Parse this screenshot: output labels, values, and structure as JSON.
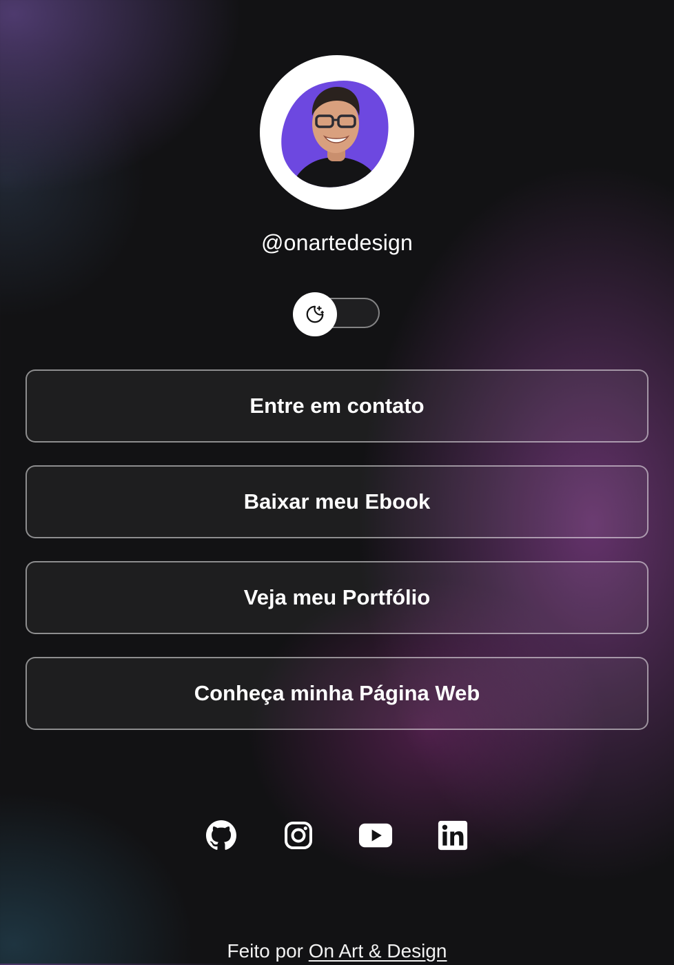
{
  "profile": {
    "username": "@onartedesign",
    "avatar_icon": "profile-photo"
  },
  "theme_toggle": {
    "icon": "moon-stars-icon",
    "state": "dark"
  },
  "links": [
    {
      "label": "Entre em contato"
    },
    {
      "label": "Baixar meu Ebook"
    },
    {
      "label": "Veja meu Portfólio"
    },
    {
      "label": "Conheça minha Página Web"
    }
  ],
  "social": [
    {
      "icon": "github-icon"
    },
    {
      "icon": "instagram-icon"
    },
    {
      "icon": "youtube-icon"
    },
    {
      "icon": "linkedin-icon"
    }
  ],
  "footer": {
    "prefix": "Feito por ",
    "link_text": "On Art & Design"
  },
  "colors": {
    "avatar_blob": "#6d48e0",
    "background": "#121214",
    "accent_glow": "#7a3a8c"
  }
}
